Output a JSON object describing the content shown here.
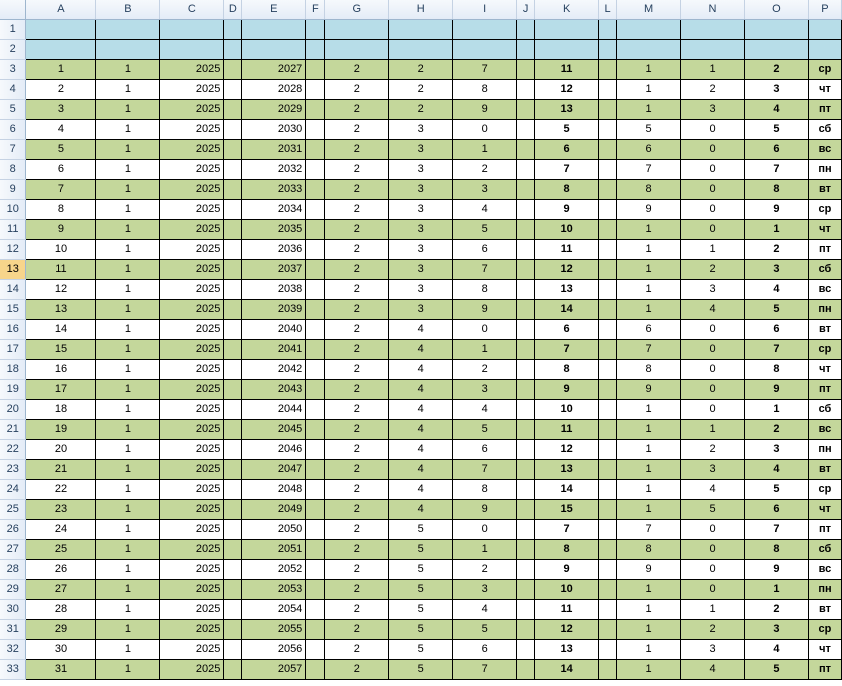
{
  "columns": [
    "A",
    "B",
    "C",
    "D",
    "E",
    "F",
    "G",
    "H",
    "I",
    "J",
    "K",
    "L",
    "M",
    "N",
    "O",
    "P"
  ],
  "header_rows": [
    "1",
    "2"
  ],
  "active_row": "13",
  "rows": [
    {
      "r": "3",
      "A": "1",
      "B": "1",
      "C": "2025",
      "E": "2027",
      "G": "2",
      "H": "2",
      "I": "7",
      "K": "11",
      "M": "1",
      "N": "1",
      "O": "2",
      "P": "ср"
    },
    {
      "r": "4",
      "A": "2",
      "B": "1",
      "C": "2025",
      "E": "2028",
      "G": "2",
      "H": "2",
      "I": "8",
      "K": "12",
      "M": "1",
      "N": "2",
      "O": "3",
      "P": "чт"
    },
    {
      "r": "5",
      "A": "3",
      "B": "1",
      "C": "2025",
      "E": "2029",
      "G": "2",
      "H": "2",
      "I": "9",
      "K": "13",
      "M": "1",
      "N": "3",
      "O": "4",
      "P": "пт"
    },
    {
      "r": "6",
      "A": "4",
      "B": "1",
      "C": "2025",
      "E": "2030",
      "G": "2",
      "H": "3",
      "I": "0",
      "K": "5",
      "M": "5",
      "N": "0",
      "O": "5",
      "P": "сб"
    },
    {
      "r": "7",
      "A": "5",
      "B": "1",
      "C": "2025",
      "E": "2031",
      "G": "2",
      "H": "3",
      "I": "1",
      "K": "6",
      "M": "6",
      "N": "0",
      "O": "6",
      "P": "вс"
    },
    {
      "r": "8",
      "A": "6",
      "B": "1",
      "C": "2025",
      "E": "2032",
      "G": "2",
      "H": "3",
      "I": "2",
      "K": "7",
      "M": "7",
      "N": "0",
      "O": "7",
      "P": "пн"
    },
    {
      "r": "9",
      "A": "7",
      "B": "1",
      "C": "2025",
      "E": "2033",
      "G": "2",
      "H": "3",
      "I": "3",
      "K": "8",
      "M": "8",
      "N": "0",
      "O": "8",
      "P": "вт"
    },
    {
      "r": "10",
      "A": "8",
      "B": "1",
      "C": "2025",
      "E": "2034",
      "G": "2",
      "H": "3",
      "I": "4",
      "K": "9",
      "M": "9",
      "N": "0",
      "O": "9",
      "P": "ср"
    },
    {
      "r": "11",
      "A": "9",
      "B": "1",
      "C": "2025",
      "E": "2035",
      "G": "2",
      "H": "3",
      "I": "5",
      "K": "10",
      "M": "1",
      "N": "0",
      "O": "1",
      "P": "чт"
    },
    {
      "r": "12",
      "A": "10",
      "B": "1",
      "C": "2025",
      "E": "2036",
      "G": "2",
      "H": "3",
      "I": "6",
      "K": "11",
      "M": "1",
      "N": "1",
      "O": "2",
      "P": "пт"
    },
    {
      "r": "13",
      "A": "11",
      "B": "1",
      "C": "2025",
      "E": "2037",
      "G": "2",
      "H": "3",
      "I": "7",
      "K": "12",
      "M": "1",
      "N": "2",
      "O": "3",
      "P": "сб"
    },
    {
      "r": "14",
      "A": "12",
      "B": "1",
      "C": "2025",
      "E": "2038",
      "G": "2",
      "H": "3",
      "I": "8",
      "K": "13",
      "M": "1",
      "N": "3",
      "O": "4",
      "P": "вс"
    },
    {
      "r": "15",
      "A": "13",
      "B": "1",
      "C": "2025",
      "E": "2039",
      "G": "2",
      "H": "3",
      "I": "9",
      "K": "14",
      "M": "1",
      "N": "4",
      "O": "5",
      "P": "пн"
    },
    {
      "r": "16",
      "A": "14",
      "B": "1",
      "C": "2025",
      "E": "2040",
      "G": "2",
      "H": "4",
      "I": "0",
      "K": "6",
      "M": "6",
      "N": "0",
      "O": "6",
      "P": "вт"
    },
    {
      "r": "17",
      "A": "15",
      "B": "1",
      "C": "2025",
      "E": "2041",
      "G": "2",
      "H": "4",
      "I": "1",
      "K": "7",
      "M": "7",
      "N": "0",
      "O": "7",
      "P": "ср"
    },
    {
      "r": "18",
      "A": "16",
      "B": "1",
      "C": "2025",
      "E": "2042",
      "G": "2",
      "H": "4",
      "I": "2",
      "K": "8",
      "M": "8",
      "N": "0",
      "O": "8",
      "P": "чт"
    },
    {
      "r": "19",
      "A": "17",
      "B": "1",
      "C": "2025",
      "E": "2043",
      "G": "2",
      "H": "4",
      "I": "3",
      "K": "9",
      "M": "9",
      "N": "0",
      "O": "9",
      "P": "пт"
    },
    {
      "r": "20",
      "A": "18",
      "B": "1",
      "C": "2025",
      "E": "2044",
      "G": "2",
      "H": "4",
      "I": "4",
      "K": "10",
      "M": "1",
      "N": "0",
      "O": "1",
      "P": "сб"
    },
    {
      "r": "21",
      "A": "19",
      "B": "1",
      "C": "2025",
      "E": "2045",
      "G": "2",
      "H": "4",
      "I": "5",
      "K": "11",
      "M": "1",
      "N": "1",
      "O": "2",
      "P": "вс"
    },
    {
      "r": "22",
      "A": "20",
      "B": "1",
      "C": "2025",
      "E": "2046",
      "G": "2",
      "H": "4",
      "I": "6",
      "K": "12",
      "M": "1",
      "N": "2",
      "O": "3",
      "P": "пн"
    },
    {
      "r": "23",
      "A": "21",
      "B": "1",
      "C": "2025",
      "E": "2047",
      "G": "2",
      "H": "4",
      "I": "7",
      "K": "13",
      "M": "1",
      "N": "3",
      "O": "4",
      "P": "вт"
    },
    {
      "r": "24",
      "A": "22",
      "B": "1",
      "C": "2025",
      "E": "2048",
      "G": "2",
      "H": "4",
      "I": "8",
      "K": "14",
      "M": "1",
      "N": "4",
      "O": "5",
      "P": "ср"
    },
    {
      "r": "25",
      "A": "23",
      "B": "1",
      "C": "2025",
      "E": "2049",
      "G": "2",
      "H": "4",
      "I": "9",
      "K": "15",
      "M": "1",
      "N": "5",
      "O": "6",
      "P": "чт"
    },
    {
      "r": "26",
      "A": "24",
      "B": "1",
      "C": "2025",
      "E": "2050",
      "G": "2",
      "H": "5",
      "I": "0",
      "K": "7",
      "M": "7",
      "N": "0",
      "O": "7",
      "P": "пт"
    },
    {
      "r": "27",
      "A": "25",
      "B": "1",
      "C": "2025",
      "E": "2051",
      "G": "2",
      "H": "5",
      "I": "1",
      "K": "8",
      "M": "8",
      "N": "0",
      "O": "8",
      "P": "сб"
    },
    {
      "r": "28",
      "A": "26",
      "B": "1",
      "C": "2025",
      "E": "2052",
      "G": "2",
      "H": "5",
      "I": "2",
      "K": "9",
      "M": "9",
      "N": "0",
      "O": "9",
      "P": "вс"
    },
    {
      "r": "29",
      "A": "27",
      "B": "1",
      "C": "2025",
      "E": "2053",
      "G": "2",
      "H": "5",
      "I": "3",
      "K": "10",
      "M": "1",
      "N": "0",
      "O": "1",
      "P": "пн"
    },
    {
      "r": "30",
      "A": "28",
      "B": "1",
      "C": "2025",
      "E": "2054",
      "G": "2",
      "H": "5",
      "I": "4",
      "K": "11",
      "M": "1",
      "N": "1",
      "O": "2",
      "P": "вт"
    },
    {
      "r": "31",
      "A": "29",
      "B": "1",
      "C": "2025",
      "E": "2055",
      "G": "2",
      "H": "5",
      "I": "5",
      "K": "12",
      "M": "1",
      "N": "2",
      "O": "3",
      "P": "ср"
    },
    {
      "r": "32",
      "A": "30",
      "B": "1",
      "C": "2025",
      "E": "2056",
      "G": "2",
      "H": "5",
      "I": "6",
      "K": "13",
      "M": "1",
      "N": "3",
      "O": "4",
      "P": "чт"
    },
    {
      "r": "33",
      "A": "31",
      "B": "1",
      "C": "2025",
      "E": "2057",
      "G": "2",
      "H": "5",
      "I": "7",
      "K": "14",
      "M": "1",
      "N": "4",
      "O": "5",
      "P": "пт"
    }
  ]
}
